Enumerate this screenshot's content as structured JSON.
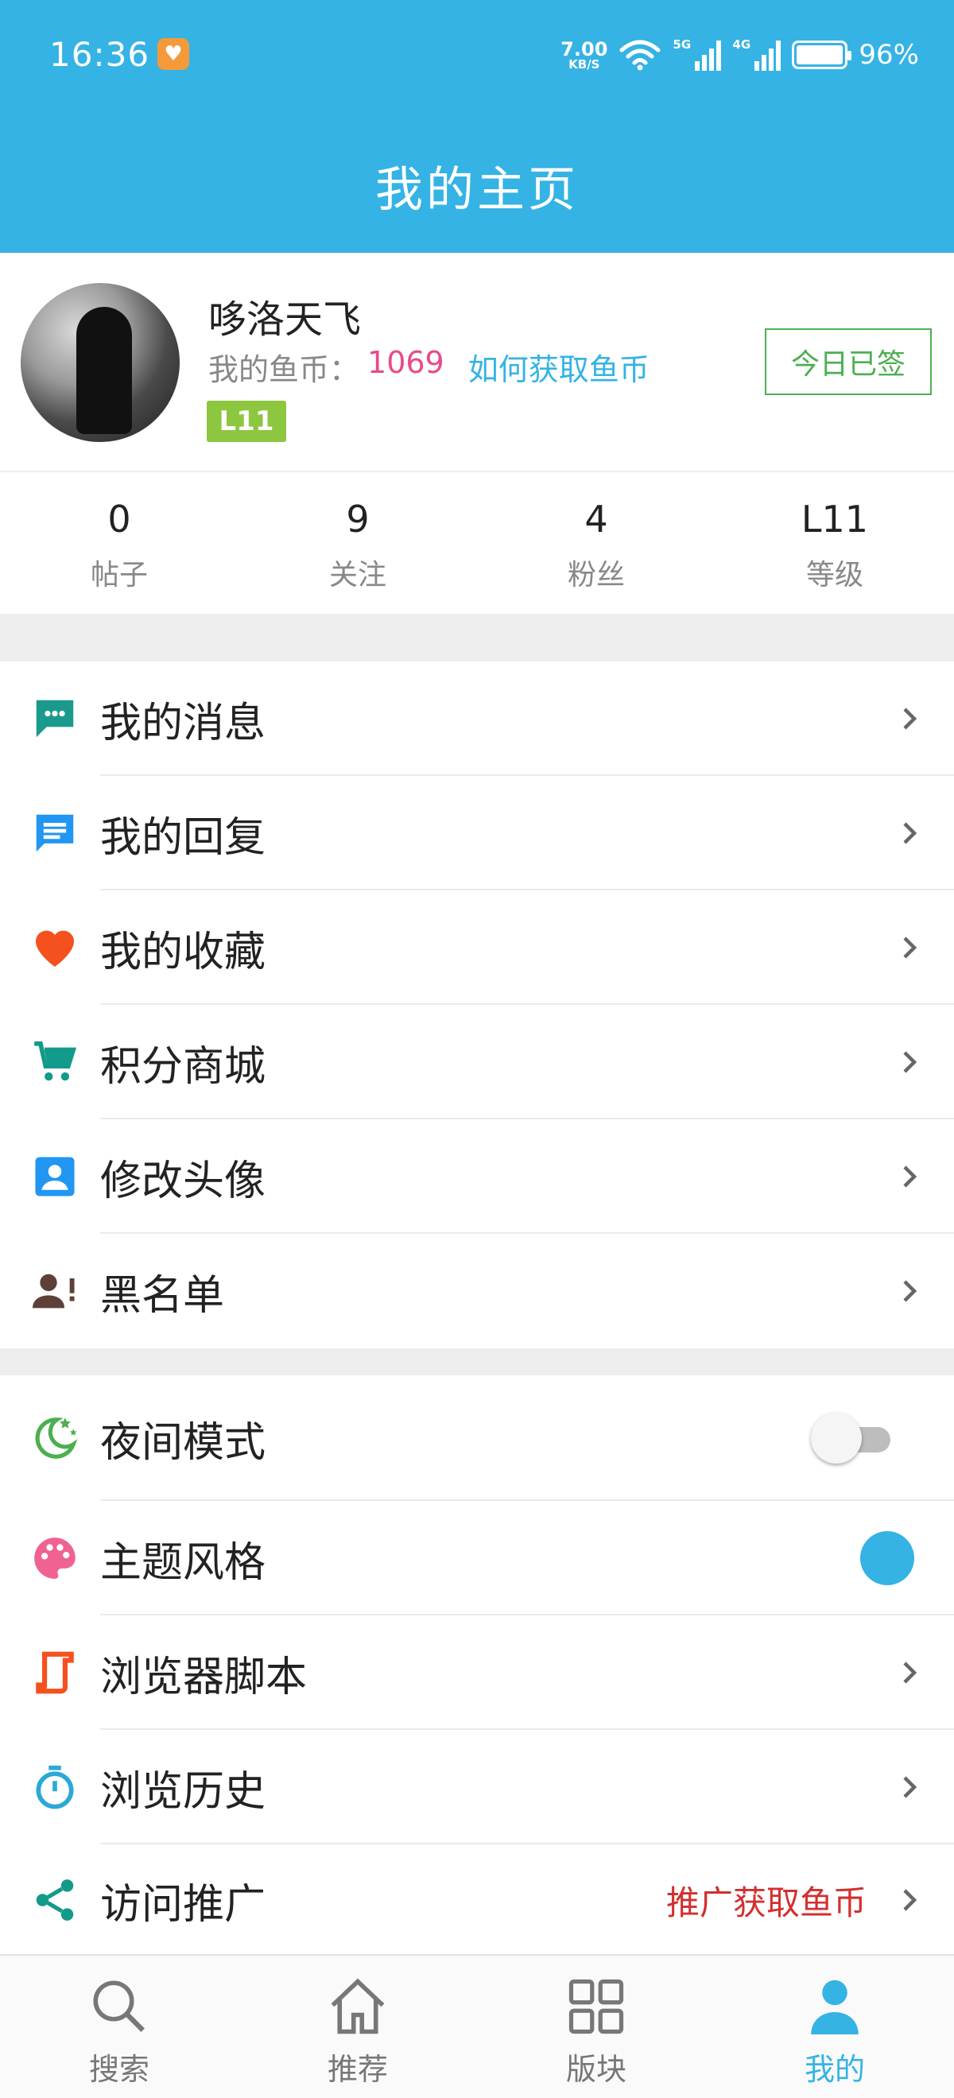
{
  "status_bar": {
    "time": "16:36",
    "net_speed_value": "7.00",
    "net_speed_unit": "KB/S",
    "signal1_tag": "5G",
    "signal2_tag": "4G",
    "battery": "96%"
  },
  "header": {
    "title": "我的主页"
  },
  "profile": {
    "username": "哆洛天飞",
    "coins_label": "我的鱼币：",
    "coins_value": "1069",
    "coins_link": "如何获取鱼币",
    "level_badge": "L11",
    "checkin_label": "今日已签"
  },
  "stats": [
    {
      "value": "0",
      "label": "帖子"
    },
    {
      "value": "9",
      "label": "关注"
    },
    {
      "value": "4",
      "label": "粉丝"
    },
    {
      "value": "L11",
      "label": "等级"
    }
  ],
  "menu_primary": [
    {
      "label": "我的消息",
      "icon": "chat-bubble-icon"
    },
    {
      "label": "我的回复",
      "icon": "reply-message-icon"
    },
    {
      "label": "我的收藏",
      "icon": "heart-icon"
    },
    {
      "label": "积分商城",
      "icon": "shopping-cart-icon"
    },
    {
      "label": "修改头像",
      "icon": "contact-card-icon"
    },
    {
      "label": "黑名单",
      "icon": "blocked-user-icon"
    }
  ],
  "menu_secondary": [
    {
      "label": "夜间模式",
      "icon": "moon-icon",
      "toggle_on": false
    },
    {
      "label": "主题风格",
      "icon": "palette-icon",
      "theme_color": "#35b3e4"
    },
    {
      "label": "浏览器脚本",
      "icon": "script-icon"
    },
    {
      "label": "浏览历史",
      "icon": "stopwatch-icon"
    },
    {
      "label": "访问推广",
      "icon": "share-icon",
      "extra": "推广获取鱼币"
    }
  ],
  "bottom_nav": [
    {
      "label": "搜索",
      "icon": "search-icon",
      "active": false
    },
    {
      "label": "推荐",
      "icon": "home-icon",
      "active": false
    },
    {
      "label": "版块",
      "icon": "grid-icon",
      "active": false
    },
    {
      "label": "我的",
      "icon": "person-icon",
      "active": true
    }
  ],
  "colors": {
    "primary": "#35b3e4",
    "coins": "#e84a8a",
    "level_badge": "#8dc63f",
    "checkin": "#4caf50",
    "promo": "#d32f2f"
  }
}
